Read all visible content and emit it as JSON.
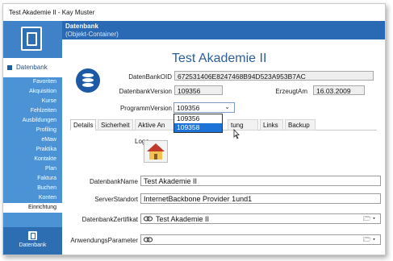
{
  "window": {
    "title": "Test Akademie II - Kay Muster"
  },
  "sidebar": {
    "section_label": "Datenbank",
    "items": [
      {
        "label": "Favoriten"
      },
      {
        "label": "Akquisition"
      },
      {
        "label": "Kurse"
      },
      {
        "label": "Fehlzeiten"
      },
      {
        "label": "Ausbildungen"
      },
      {
        "label": "Profiling"
      },
      {
        "label": "eMaw"
      },
      {
        "label": "Praktika"
      },
      {
        "label": "Kontakte"
      },
      {
        "label": "Plan"
      },
      {
        "label": "Faktura"
      },
      {
        "label": "Buchen"
      },
      {
        "label": "Konten"
      },
      {
        "label": "Einrichtung"
      }
    ],
    "bottom_label": "Datenbank"
  },
  "header": {
    "title": "Datenbank",
    "subtitle": "(Objekt-Container)"
  },
  "main": {
    "title": "Test Akademie II",
    "oid_label": "DatenBankOID",
    "oid_value": "672531406E8247468B94D523A953B7AC",
    "version_label": "DatenbankVersion",
    "version_value": "109356",
    "created_label": "ErzeugtAm",
    "created_value": "16.03.2009",
    "program_version_label": "ProgrammVersion",
    "program_version_value": "109356",
    "program_version_options": [
      "109356",
      "109358"
    ],
    "tabs": [
      {
        "label": "Details"
      },
      {
        "label": "Sicherheit"
      },
      {
        "label": "Aktive An"
      },
      {
        "label": "tung"
      },
      {
        "label": "Links"
      },
      {
        "label": "Backup"
      }
    ],
    "logo_label": "Logo",
    "db_name_label": "DatenbankName",
    "db_name_value": "Test Akademie II",
    "server_label": "ServerStandort",
    "server_value": "InternetBackbone Provider 1und1",
    "cert_label": "DatenbankZertifikat",
    "cert_value": "Test Akademie II",
    "params_label": "AnwendungsParameter",
    "params_value": ""
  },
  "colors": {
    "sidebar_bg": "#4c93d5",
    "header_bg": "#2a69b3",
    "title_color": "#2b5e99",
    "selection": "#1e73d8"
  },
  "icons": {
    "app": "app-logo-icon",
    "database": "database-icon",
    "house": "house-icon",
    "link": "link-icon",
    "folder": "folder-open-icon",
    "dropdown": "chevron-down-icon"
  }
}
